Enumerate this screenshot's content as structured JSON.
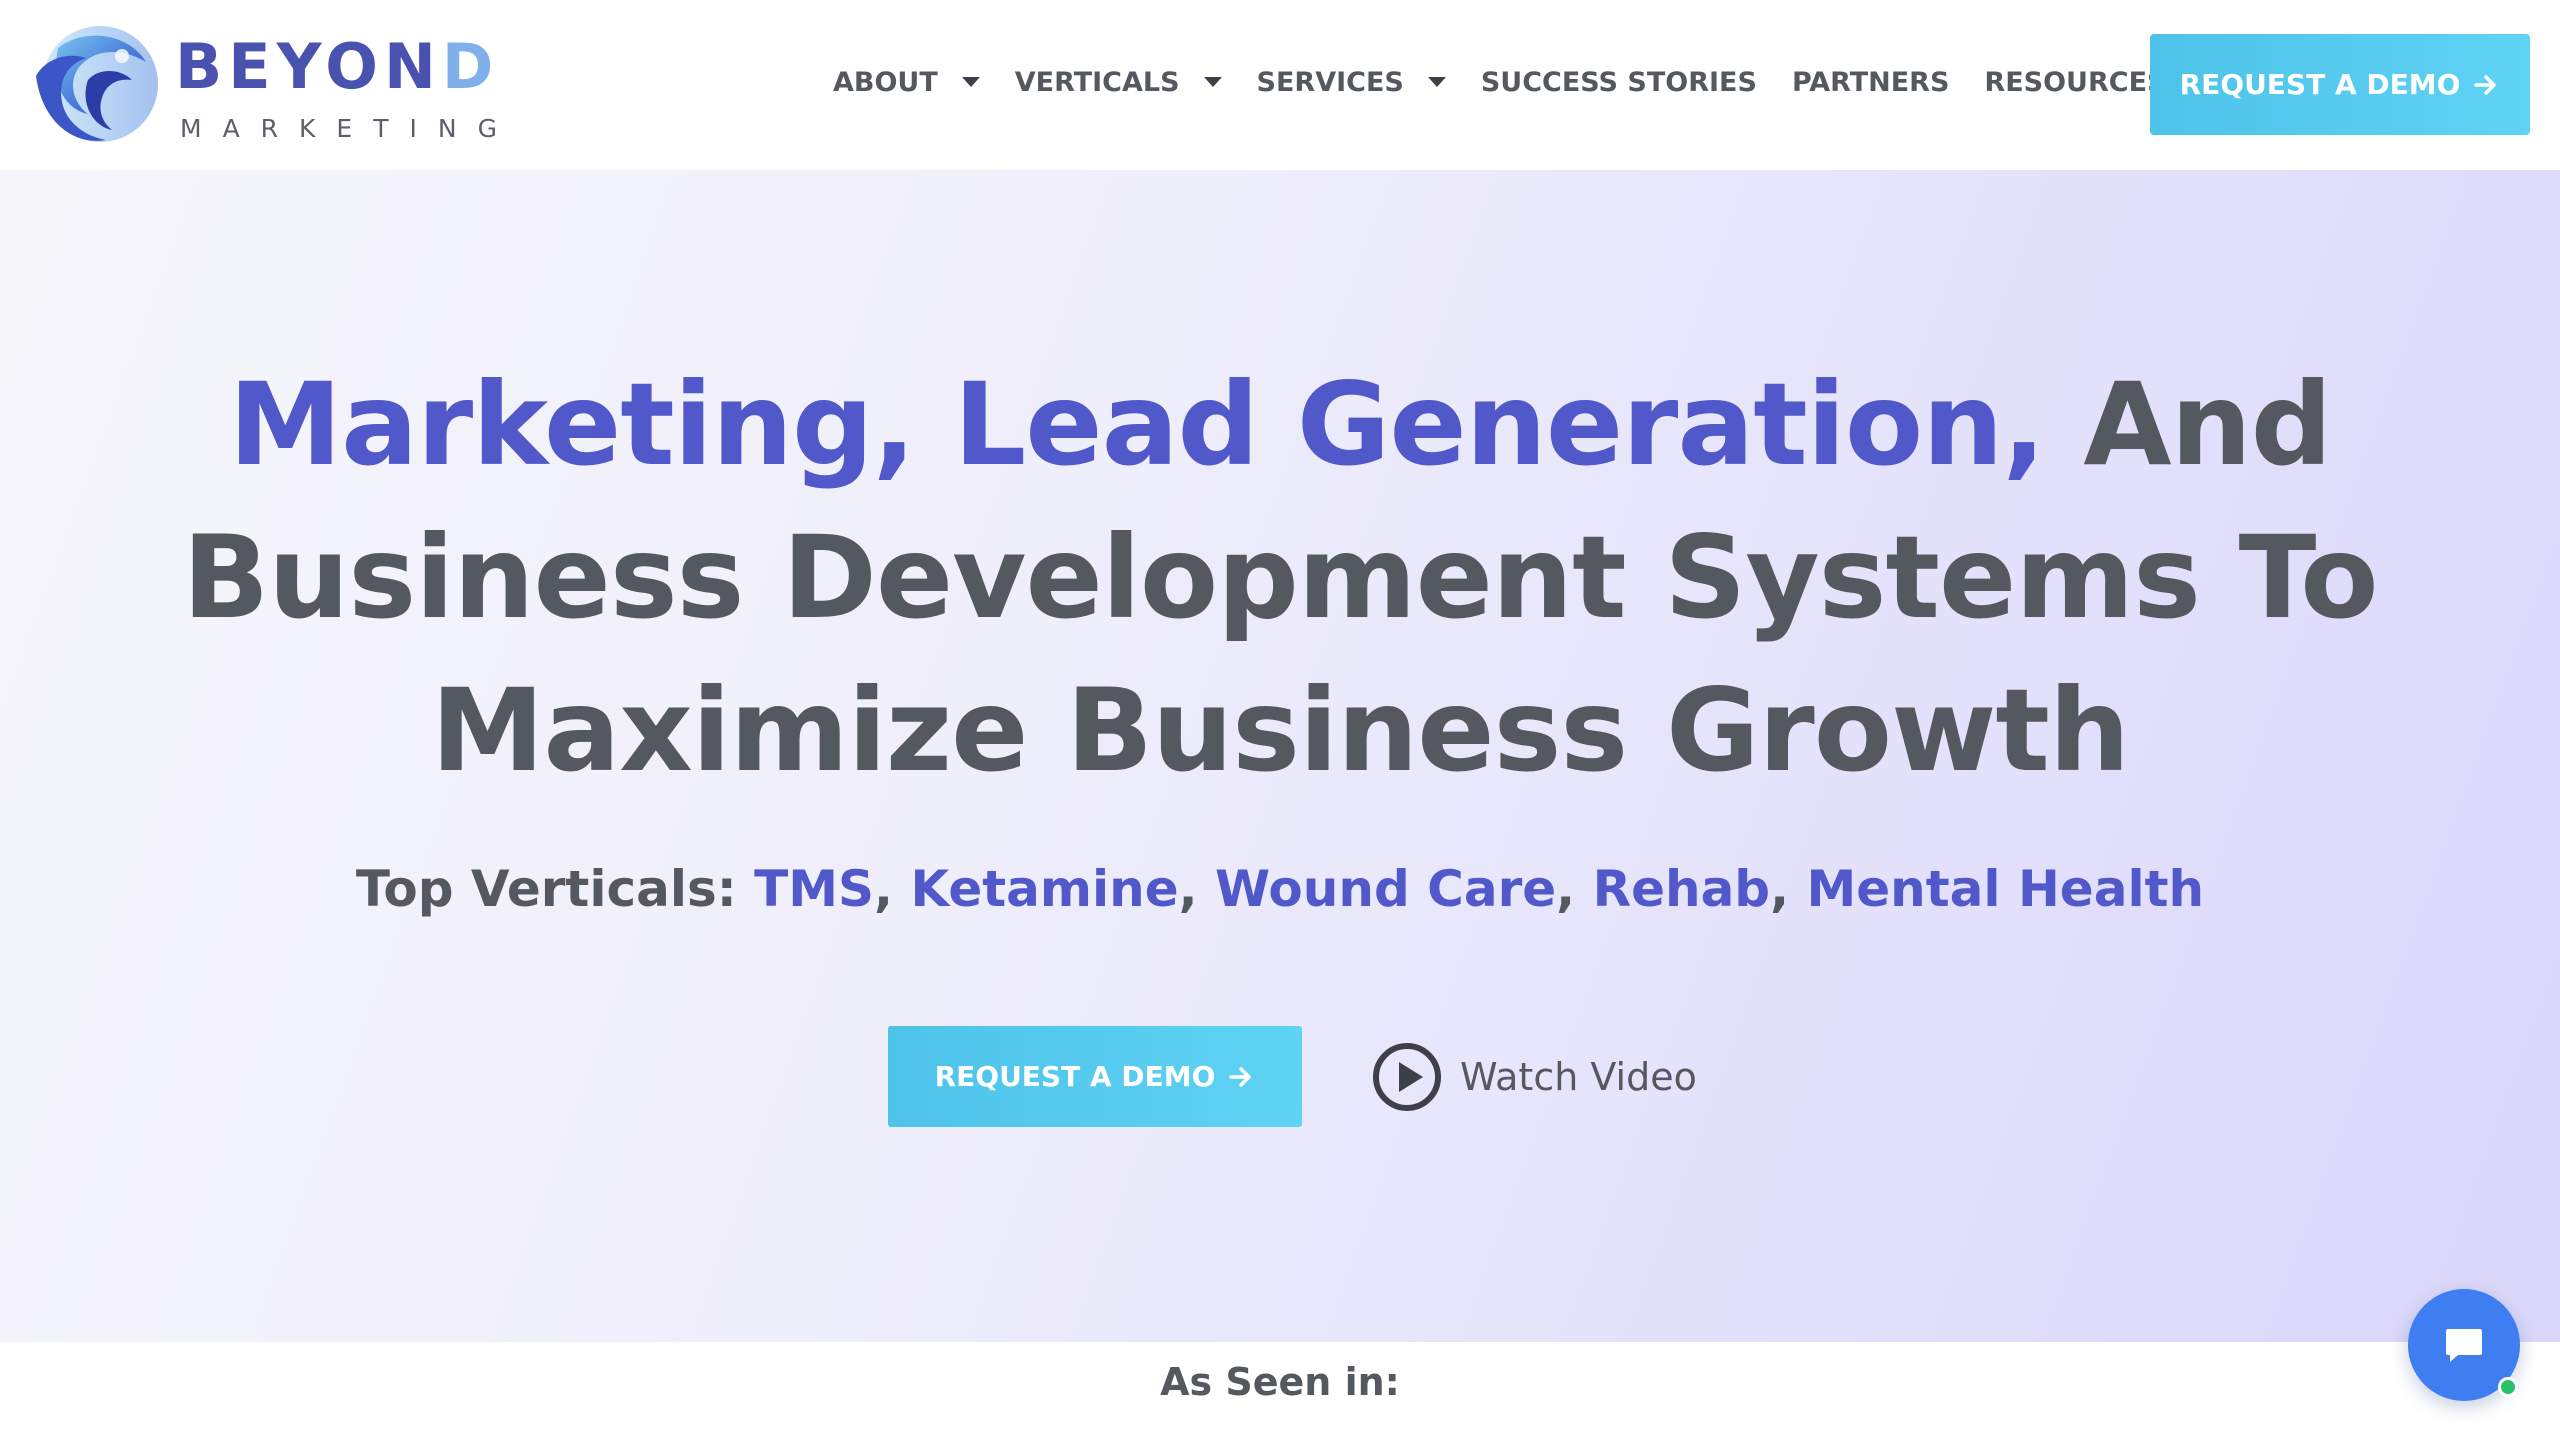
{
  "brand": {
    "name_main": "BEYON",
    "name_fade": "D",
    "tagline": "MARKETING"
  },
  "nav": {
    "items": [
      {
        "label": "ABOUT",
        "has_dropdown": true
      },
      {
        "label": "VERTICALS",
        "has_dropdown": true
      },
      {
        "label": "SERVICES",
        "has_dropdown": true
      },
      {
        "label": "SUCCESS STORIES",
        "has_dropdown": false
      },
      {
        "label": "PARTNERS",
        "has_dropdown": false
      },
      {
        "label": "RESOURCES",
        "has_dropdown": true
      }
    ],
    "cta_label": "REQUEST A DEMO"
  },
  "hero": {
    "title_accent": "Marketing, Lead Generation,",
    "title_rest_line1": " And",
    "title_line2": "Business Development Systems To",
    "title_line3": "Maximize Business Growth",
    "verticals_label": "Top Verticals: ",
    "verticals": [
      "TMS",
      "Ketamine",
      "Wound Care",
      "Rehab",
      "Mental Health"
    ],
    "separator": ", ",
    "cta_label": "REQUEST A DEMO",
    "watch_label": "Watch Video"
  },
  "as_seen": {
    "label": "As Seen in:"
  },
  "colors": {
    "accent": "#5158c9",
    "cta": "#4ec3ea",
    "text": "#54595f",
    "chat": "#3e7ef0",
    "online": "#28c26a"
  },
  "icons": {
    "logo": "beyond-swirl-logo",
    "caret": "caret-down-icon",
    "arrow": "arrow-right-icon",
    "play": "play-circle-icon",
    "chat": "chat-bubble-icon"
  }
}
